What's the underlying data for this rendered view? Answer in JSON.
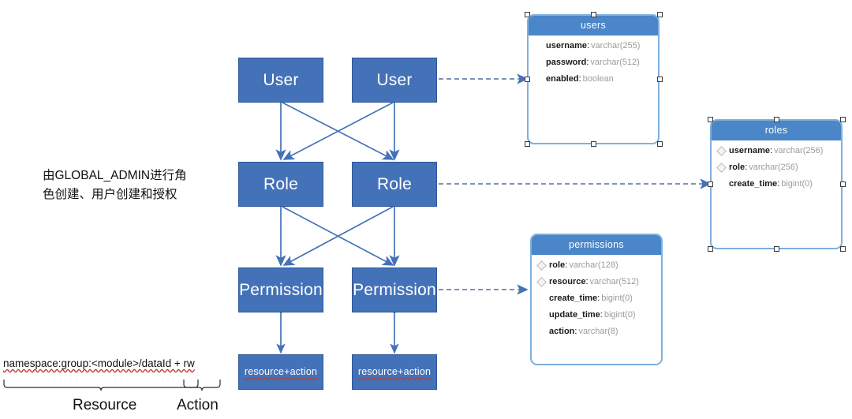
{
  "diagram": {
    "title": "RBAC permission model diagram",
    "colors": {
      "box_fill": "#4472b8",
      "box_stroke": "#2f5597",
      "table_header": "#4a86c8",
      "table_border": "#7fb0de",
      "arrow": "#4472b8",
      "dashed_connector": "#6d84ab",
      "spellcheck_underline": "#c0392b"
    }
  },
  "flow": {
    "boxes": [
      {
        "id": "user-left",
        "label": "User"
      },
      {
        "id": "user-right",
        "label": "User"
      },
      {
        "id": "role-left",
        "label": "Role"
      },
      {
        "id": "role-right",
        "label": "Role"
      },
      {
        "id": "permission-left",
        "label": "Permission"
      },
      {
        "id": "permission-right",
        "label": "Permission"
      },
      {
        "id": "resaction-left",
        "label": "resource+action"
      },
      {
        "id": "resaction-right",
        "label": "resource+action"
      }
    ]
  },
  "annotations": {
    "admin_note": "由GLOBAL_ADMIN进行角\n色创建、用户创建和授权",
    "resource_expression": "namespace:group:<module>/dataId + rw",
    "resource_caption": "Resource",
    "action_caption": "Action"
  },
  "tables": [
    {
      "id": "users",
      "name": "users",
      "selected": true,
      "fields": [
        {
          "name": "username",
          "type": "varchar(255)",
          "key": false
        },
        {
          "name": "password",
          "type": "varchar(512)",
          "key": false
        },
        {
          "name": "enabled",
          "type": "boolean",
          "key": false
        }
      ]
    },
    {
      "id": "roles",
      "name": "roles",
      "selected": true,
      "fields": [
        {
          "name": "username",
          "type": "varchar(256)",
          "key": true
        },
        {
          "name": "role",
          "type": "varchar(256)",
          "key": true
        },
        {
          "name": "create_time",
          "type": "bigint(0)",
          "key": false
        }
      ]
    },
    {
      "id": "permissions",
      "name": "permissions",
      "selected": false,
      "fields": [
        {
          "name": "role",
          "type": "varchar(128)",
          "key": true
        },
        {
          "name": "resource",
          "type": "varchar(512)",
          "key": true
        },
        {
          "name": "create_time",
          "type": "bigint(0)",
          "key": false
        },
        {
          "name": "update_time",
          "type": "bigint(0)",
          "key": false
        },
        {
          "name": "action",
          "type": "varchar(8)",
          "key": false
        }
      ]
    }
  ]
}
